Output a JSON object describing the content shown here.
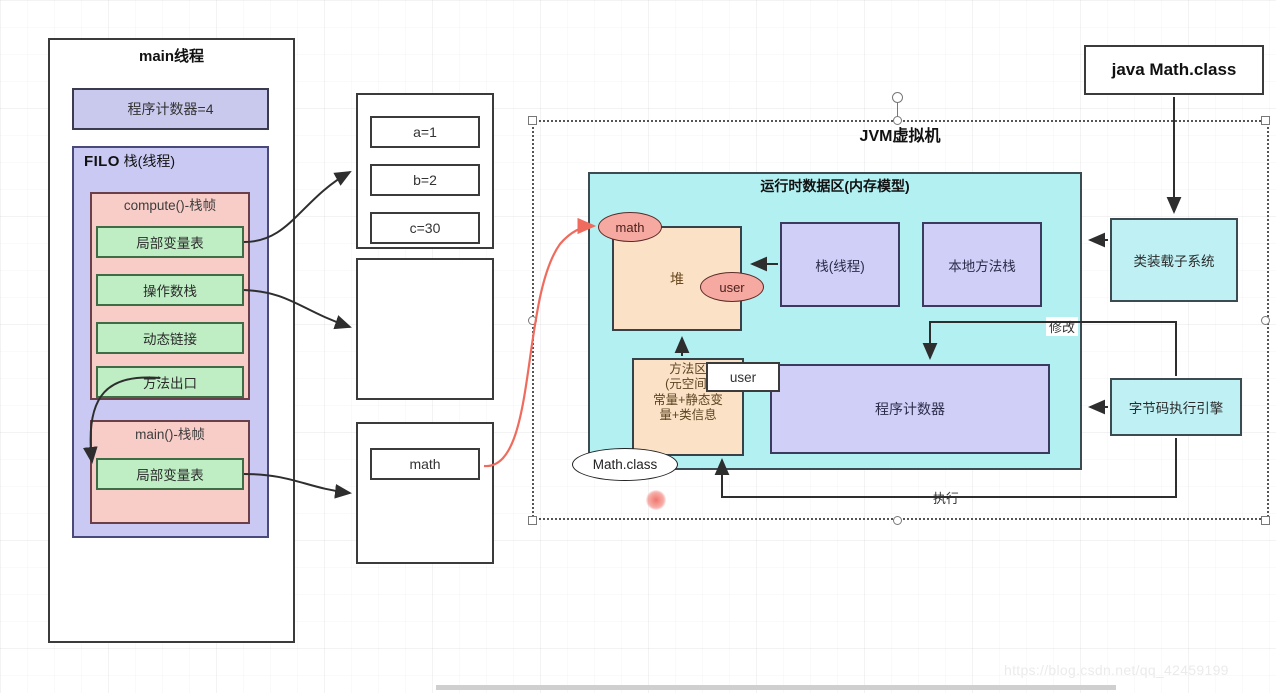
{
  "background": {
    "watermark": "https://blog.csdn.net/qq_42459199"
  },
  "main_thread": {
    "title": "main线程",
    "program_counter": "程序计数器=4",
    "filo_label": "FILO",
    "stack_label": "栈(线程)",
    "compute_frame": {
      "title": "compute()-栈帧",
      "slots": [
        "局部变量表",
        "操作数栈",
        "动态链接",
        "方法出口"
      ]
    },
    "main_frame": {
      "title": "main()-栈帧",
      "slots": [
        "局部变量表"
      ]
    }
  },
  "middle_boxes": {
    "box1_vars": [
      "a=1",
      "b=2",
      "c=30"
    ],
    "box2_vars": [],
    "box3_vars": [
      "math"
    ]
  },
  "jvm": {
    "title": "JVM虚拟机",
    "runtime_data_area": {
      "title": "运行时数据区(内存模型)",
      "heap": "堆",
      "stack_thread": "栈(线程)",
      "native_method_stack": "本地方法栈",
      "program_counter": "程序计数器",
      "method_area_line1": "方法区",
      "method_area_line2": "(元空间)",
      "method_area_line3": "常量+静态变",
      "method_area_line4": "量+类信息",
      "user_box": "user"
    },
    "heap_objects": {
      "math": "math",
      "user": "user"
    },
    "method_area_object": "Math.class"
  },
  "right_column": {
    "source": "java Math.class",
    "class_loader": "类装载子系统",
    "execution_engine": "字节码执行引擎"
  },
  "edge_labels": {
    "modify": "修改",
    "execute": "执行"
  },
  "colors": {
    "heap_fill": "#fbe2c6",
    "stack_fill": "#cfcff7",
    "rda_fill": "#b2f0f2",
    "loader_fill": "#bff0f4",
    "frame_fill": "#f8cdc8",
    "slot_fill": "#bfeec4",
    "object_fill": "#f6a9a0",
    "red_arrow": "#ef6b5e"
  }
}
